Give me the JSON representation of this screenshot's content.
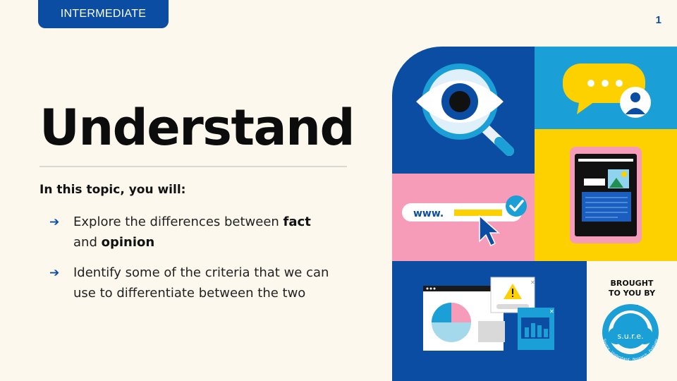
{
  "badge": "INTERMEDIATE",
  "page_number": "1",
  "title": "Understand",
  "intro": "In this topic, you will:",
  "bullets": [
    {
      "parts": [
        "Explore the differences between ",
        "fact",
        " and ",
        "opinion"
      ]
    },
    {
      "text": "Identify some of the criteria that we can use to differentiate between the two"
    }
  ],
  "illustration": {
    "url_text": "www.",
    "brought_line1": "BROUGHT",
    "brought_line2": "TO YOU BY",
    "logo_text": "s.u.r.e.",
    "logo_ring": "Source · Understand · Research · Evaluate"
  },
  "colors": {
    "navy": "#0a4da2",
    "sky": "#1a9fd6",
    "yellow": "#fdd000",
    "pink": "#f79cb8",
    "cream": "#fcf8ee"
  }
}
